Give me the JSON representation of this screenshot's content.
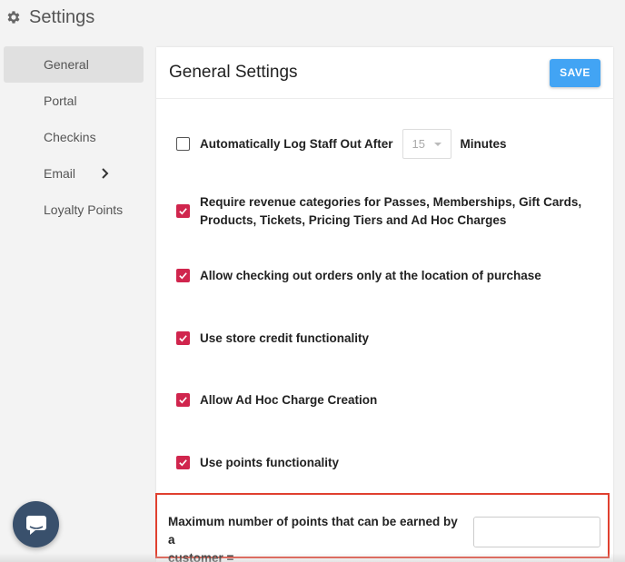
{
  "header": {
    "title": "Settings",
    "icon": "gear-icon"
  },
  "sidebar": {
    "items": [
      {
        "label": "General",
        "active": true
      },
      {
        "label": "Portal"
      },
      {
        "label": "Checkins"
      },
      {
        "label": "Email",
        "has_submenu": true
      },
      {
        "label": "Loyalty Points"
      }
    ]
  },
  "panel": {
    "title": "General Settings",
    "save_label": "SAVE",
    "options": {
      "auto_logout": {
        "label_before": "Automatically Log Staff Out After",
        "select_value": "15",
        "label_after": "Minutes",
        "checked": false
      },
      "revenue_categories": {
        "line1": "Require revenue categories for Passes, Memberships, Gift Cards,",
        "line2": "Products, Tickets, Pricing Tiers and Ad Hoc Charges",
        "checked": true
      },
      "checkout_location": {
        "label": "Allow checking out orders only at the location of purchase",
        "checked": true
      },
      "store_credit": {
        "label": "Use store credit functionality",
        "checked": true
      },
      "ad_hoc": {
        "label": "Allow Ad Hoc Charge Creation",
        "checked": true
      },
      "points": {
        "label": "Use points functionality",
        "checked": true
      }
    },
    "max_points": {
      "line1": "Maximum number of points that can be earned by a",
      "line2": "customer =",
      "value": ""
    }
  },
  "colors": {
    "accent": "#42a4f4",
    "checkbox": "#d0254d",
    "highlight": "#e0402f",
    "chat": "#39506c"
  }
}
